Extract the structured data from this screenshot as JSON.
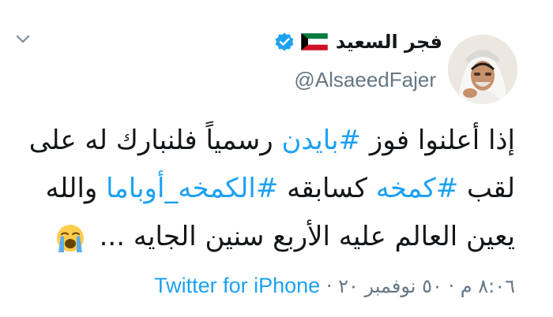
{
  "tweet": {
    "display_name": "فجر السعيد",
    "handle": "@AlsaeedFajer",
    "text_parts": [
      {
        "text": "إذا أعلنوا فوز ",
        "type": "text"
      },
      {
        "text": "#بايدن",
        "type": "hashtag"
      },
      {
        "text": " رسمياً فلنبارك له على لقب  ",
        "type": "text"
      },
      {
        "text": "#كمخه",
        "type": "hashtag"
      },
      {
        "text": "  كسابقه ",
        "type": "text"
      },
      {
        "text": "#الكمخه_أوباما",
        "type": "hashtag"
      },
      {
        "text": " والله يعين العالم عليه الأربع سنين الجايه ...",
        "type": "text"
      }
    ],
    "emoji": "loudly-crying-face",
    "timestamp": "٨:٠٦ م · ٥٠ نوفمبر ٢٠",
    "separator": "·",
    "source": "Twitter for iPhone"
  },
  "icons": {
    "menu": "chevron-down-icon",
    "verified": "verified-badge-icon",
    "flag": "kuwait-flag-icon"
  },
  "colors": {
    "link": "#1da1f2",
    "secondary_text": "#657786",
    "primary_text": "#14171a",
    "verified": "#1da1f2"
  }
}
